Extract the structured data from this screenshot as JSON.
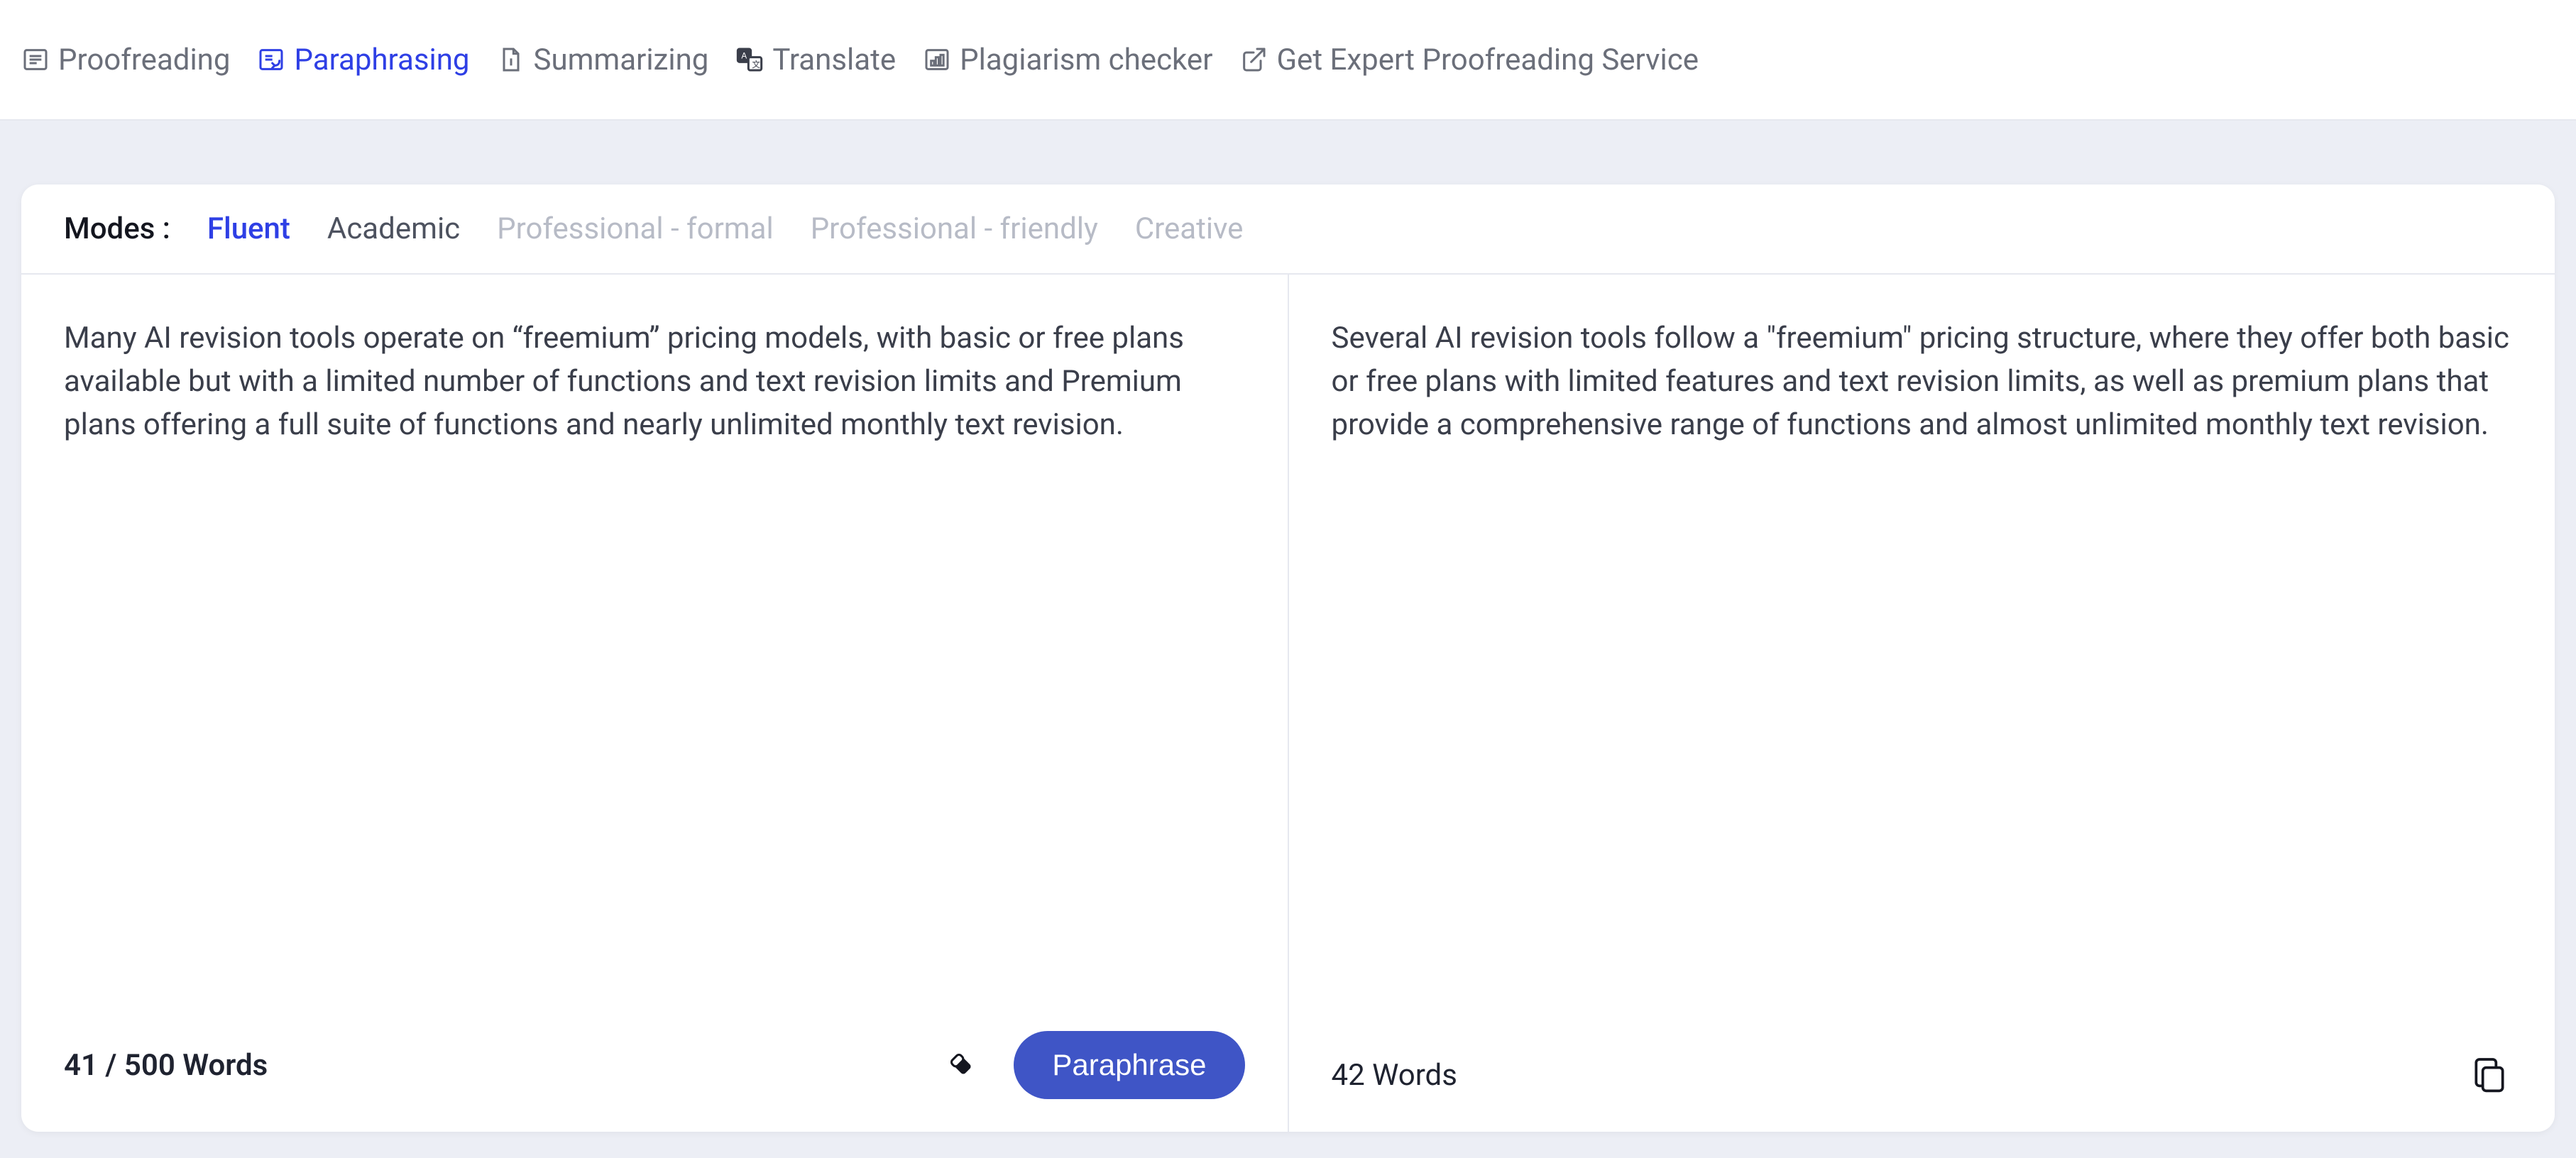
{
  "nav": {
    "items": [
      {
        "label": "Proofreading",
        "icon": "proofreading-icon",
        "active": false
      },
      {
        "label": "Paraphrasing",
        "icon": "paraphrasing-icon",
        "active": true
      },
      {
        "label": "Summarizing",
        "icon": "summarizing-icon",
        "active": false
      },
      {
        "label": "Translate",
        "icon": "translate-icon",
        "active": false
      },
      {
        "label": "Plagiarism checker",
        "icon": "plagiarism-icon",
        "active": false
      },
      {
        "label": "Get Expert Proofreading Service",
        "icon": "external-link-icon",
        "active": false
      }
    ]
  },
  "modes": {
    "label": "Modes :",
    "items": [
      {
        "label": "Fluent",
        "state": "active"
      },
      {
        "label": "Academic",
        "state": "enabled"
      },
      {
        "label": "Professional - formal",
        "state": "disabled"
      },
      {
        "label": "Professional - friendly",
        "state": "disabled"
      },
      {
        "label": "Creative",
        "state": "disabled"
      }
    ]
  },
  "input": {
    "text": "Many AI revision tools operate on “freemium” pricing models, with basic or free plans available but with a limited number of functions and text revision limits and Premium plans offering a full suite of functions and nearly unlimited monthly text revision.",
    "counter": "41 / 500 Words",
    "action_label": "Paraphrase"
  },
  "output": {
    "text": "Several AI revision tools follow a \"freemium\" pricing structure, where they offer both basic or free plans with limited features and text revision limits, as well as premium plans that provide a comprehensive range of functions and almost unlimited monthly text revision.",
    "counter": "42 Words"
  },
  "colors": {
    "accent": "#2e3fe5",
    "button": "#3f55c6",
    "text": "#3a3e4a",
    "muted": "#6b6f7a",
    "disabled": "#b7bbc6"
  }
}
